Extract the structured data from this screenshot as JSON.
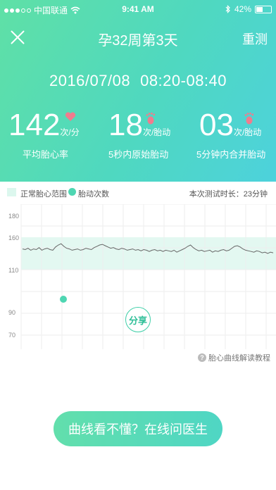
{
  "status_bar": {
    "carrier": "中国联通",
    "time": "9:41 AM",
    "battery": "42%"
  },
  "nav": {
    "title": "孕32周第3天",
    "action": "重测"
  },
  "session": {
    "datetime_date": "2016/07/08",
    "datetime_range": "08:20-08:40"
  },
  "stats": [
    {
      "value": "142",
      "unit": "次/分",
      "label": "平均胎心率",
      "icon": "heart-icon"
    },
    {
      "value": "18",
      "unit": "次/胎动",
      "label": "5秒内原始胎动",
      "icon": "foot-icon"
    },
    {
      "value": "03",
      "unit": "次/胎动",
      "label": "5分钟内合并胎动",
      "icon": "foot-icon"
    }
  ],
  "legend": {
    "normal_range": "正常胎心范围",
    "movement_count": "胎动次数",
    "duration": "本次测试时长：23分钟"
  },
  "chart_data": {
    "type": "line",
    "y_ticks": [
      "180",
      "160",
      "110",
      "90",
      "70"
    ],
    "normal_band": [
      110,
      160
    ],
    "ylim": [
      60,
      190
    ],
    "heart_rate": [
      142,
      141,
      143,
      140,
      142,
      141,
      144,
      140,
      142,
      143,
      141,
      140,
      145,
      148,
      150,
      146,
      143,
      142,
      140,
      141,
      142,
      140,
      141,
      143,
      142,
      141,
      144,
      146,
      148,
      149,
      147,
      145,
      143,
      144,
      142,
      141,
      143,
      142,
      140,
      141,
      142,
      140,
      141,
      139,
      141,
      140,
      138,
      140,
      141,
      139,
      140,
      138,
      140,
      139,
      138,
      140,
      137,
      139,
      141,
      143,
      146,
      148,
      144,
      141,
      139,
      140,
      138,
      139,
      140,
      137,
      139,
      138,
      140,
      141,
      139,
      140,
      143,
      146,
      147,
      145,
      142,
      140,
      139,
      138,
      137,
      139,
      138,
      136,
      137,
      135,
      137,
      136
    ],
    "movements": [
      {
        "index": 8,
        "y": 96
      }
    ],
    "colors": {
      "line": "#666666",
      "band": "#e3f8f1",
      "movement": "#4ed6b2"
    }
  },
  "share": {
    "label": "分享"
  },
  "tutorial": {
    "label": "胎心曲线解读教程"
  },
  "cta": {
    "label": "曲线看不懂？在线问医生"
  }
}
